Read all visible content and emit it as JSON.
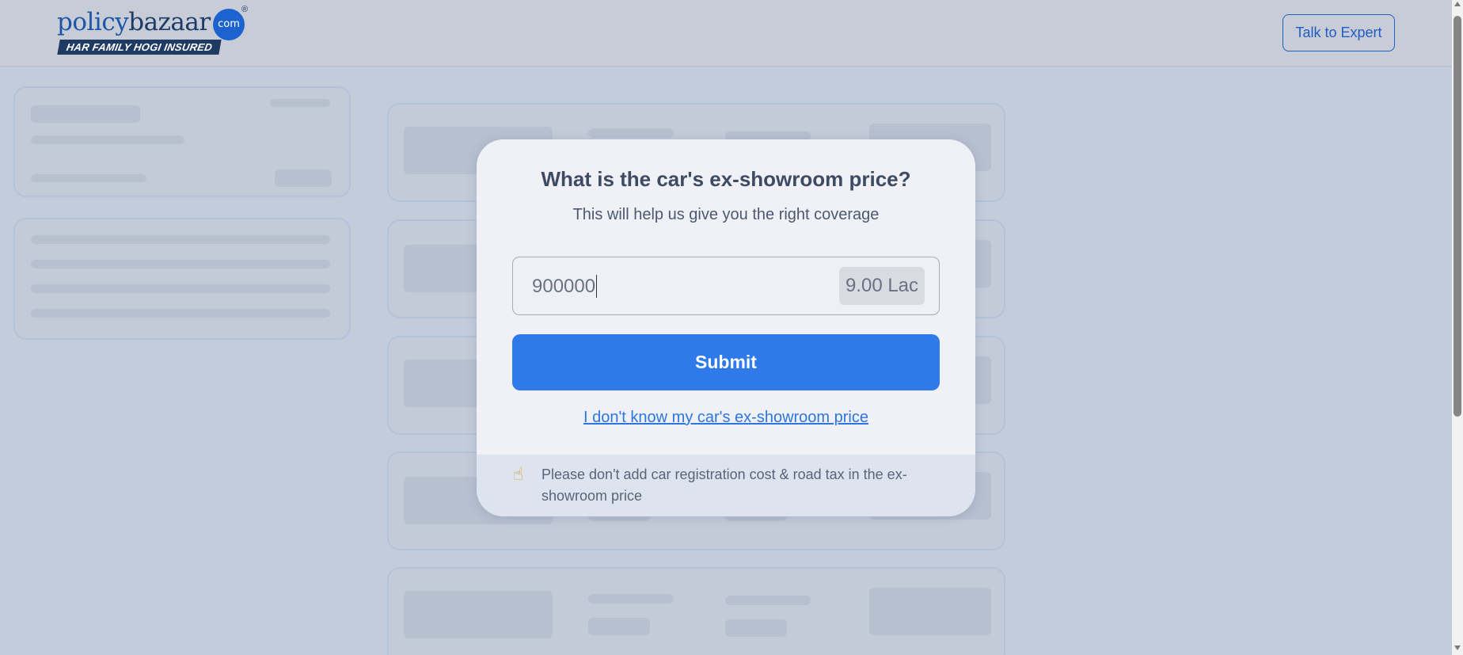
{
  "header": {
    "logo": {
      "word_policy": "policy",
      "word_bazaar": "bazaar",
      "dot_com": "com",
      "registered_mark": "®",
      "tagline": "HAR FAMILY HOGI INSURED"
    },
    "talk_to_expert_label": "Talk to Expert"
  },
  "modal": {
    "title": "What is the car's ex-showroom price?",
    "subtitle": "This will help us give you the right coverage",
    "price_input": {
      "value": "900000",
      "unit_display": "9.00 Lac"
    },
    "submit_label": "Submit",
    "dont_know_link": "I don't know my car's ex-showroom price",
    "note": {
      "icon": "pointing-hand-icon",
      "text": "Please don't add car registration cost & road tax in the ex-showroom price"
    }
  },
  "colors": {
    "brand_blue": "#1c56a8",
    "primary_button": "#2f7aea",
    "link": "#2d76e0",
    "overlay_background": "#c3ccda"
  }
}
